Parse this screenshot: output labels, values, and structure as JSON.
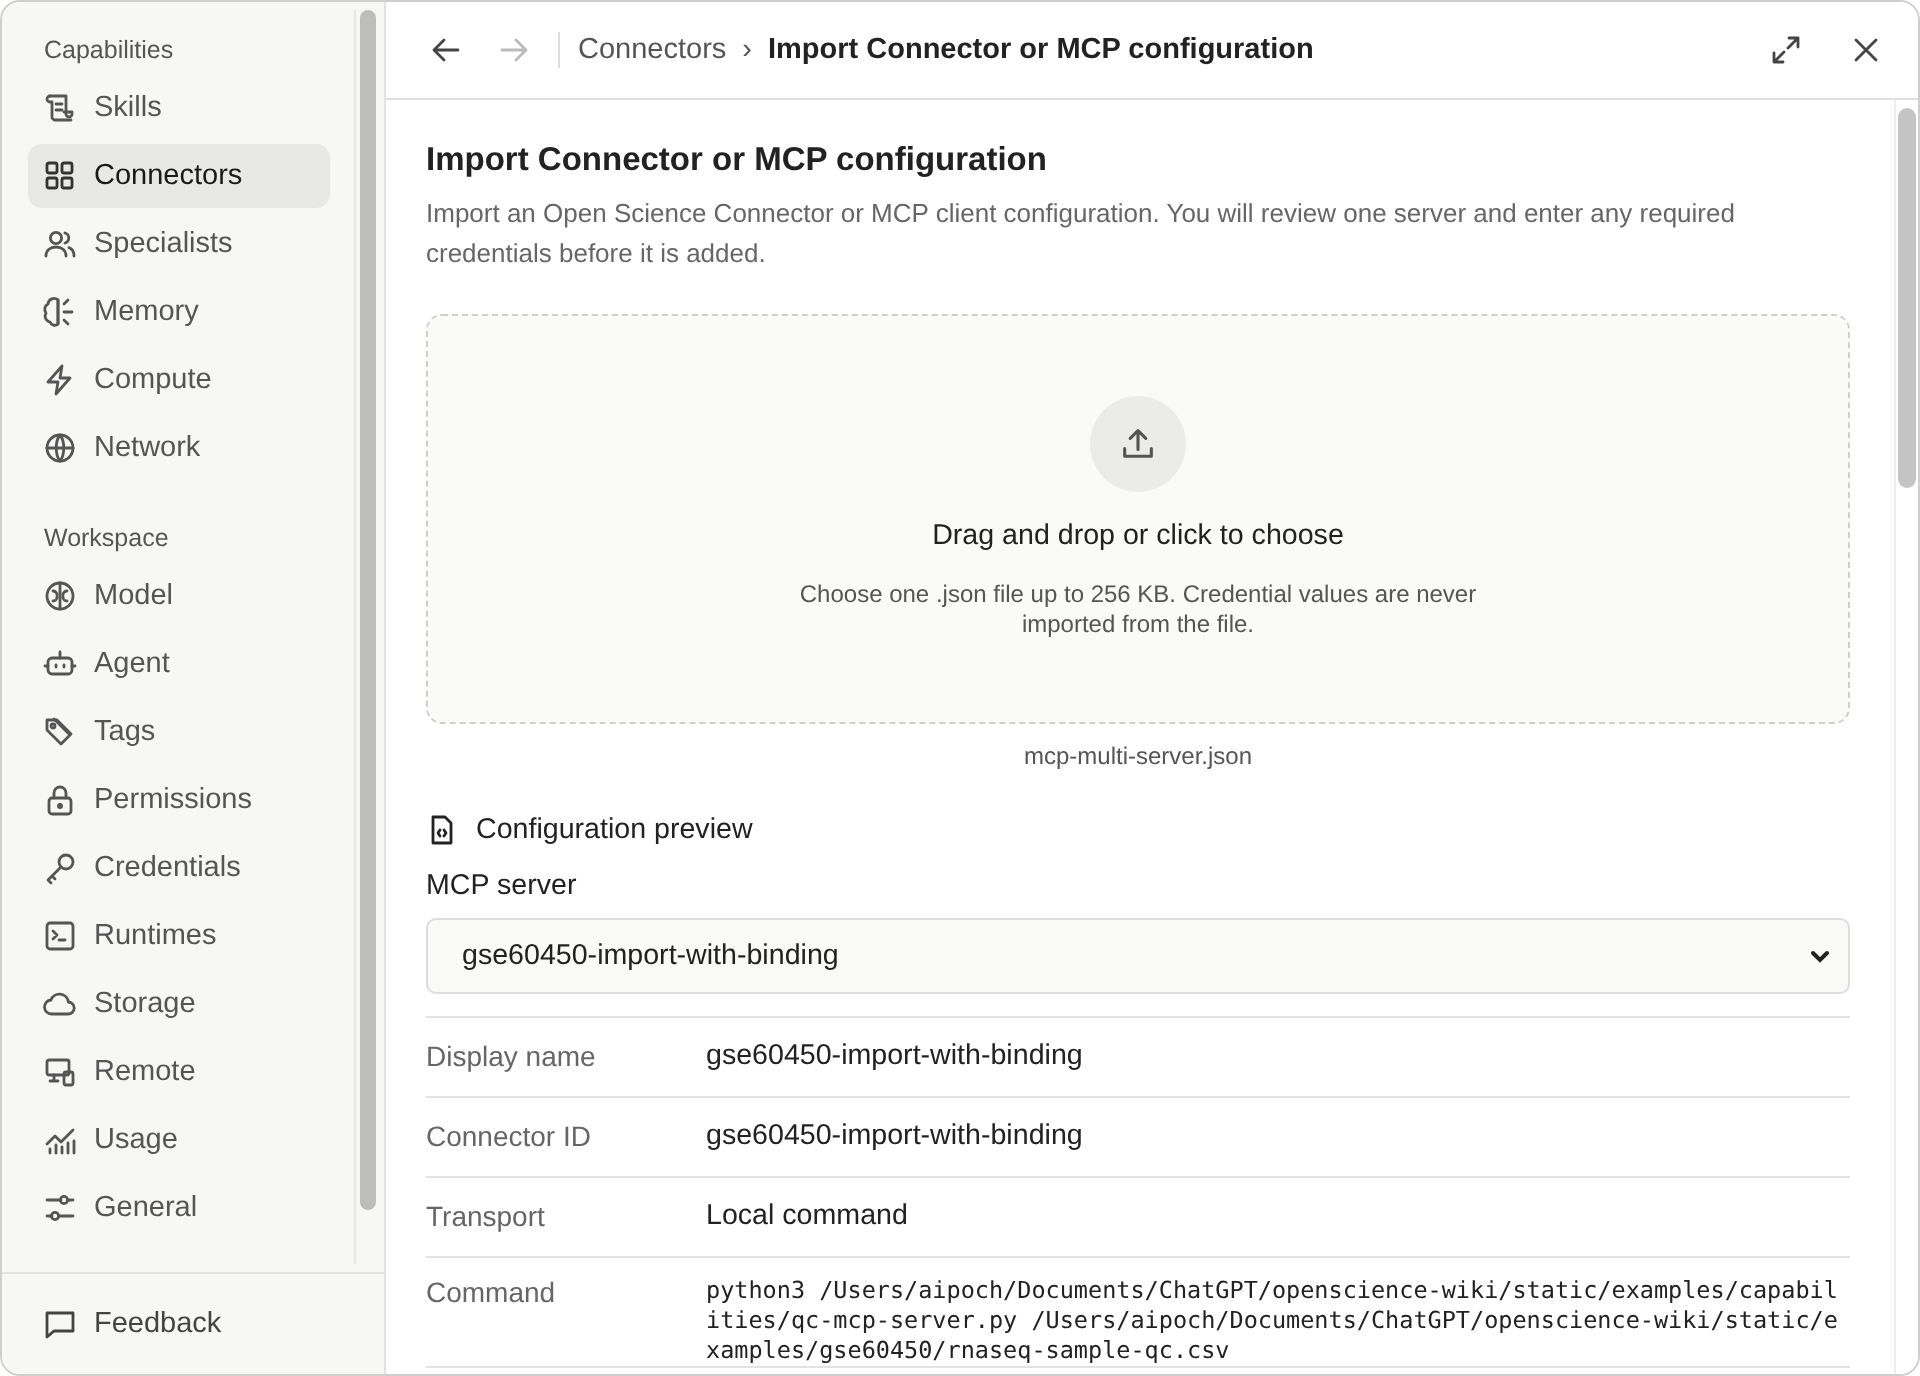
{
  "sidebar": {
    "sections": [
      {
        "title": "Capabilities",
        "items": [
          {
            "label": "Skills",
            "selected": false
          },
          {
            "label": "Connectors",
            "selected": true
          },
          {
            "label": "Specialists",
            "selected": false
          },
          {
            "label": "Memory",
            "selected": false
          },
          {
            "label": "Compute",
            "selected": false
          },
          {
            "label": "Network",
            "selected": false
          }
        ]
      },
      {
        "title": "Workspace",
        "items": [
          {
            "label": "Model",
            "selected": false
          },
          {
            "label": "Agent",
            "selected": false
          },
          {
            "label": "Tags",
            "selected": false
          },
          {
            "label": "Permissions",
            "selected": false
          },
          {
            "label": "Credentials",
            "selected": false
          },
          {
            "label": "Runtimes",
            "selected": false
          },
          {
            "label": "Storage",
            "selected": false
          },
          {
            "label": "Remote",
            "selected": false
          },
          {
            "label": "Usage",
            "selected": false
          },
          {
            "label": "General",
            "selected": false
          }
        ]
      }
    ],
    "footer": {
      "label": "Feedback"
    }
  },
  "header": {
    "breadcrumb": {
      "parent": "Connectors",
      "separator": "›",
      "current": "Import Connector or MCP configuration"
    },
    "forward_disabled": true
  },
  "content": {
    "title": "Import Connector or MCP configuration",
    "description": "Import an Open Science Connector or MCP client configuration. You will review one server and enter any required credentials before it is added.",
    "dropzone": {
      "title": "Drag and drop or click to choose",
      "hint": "Choose one .json file up to 256 KB. Credential values are never imported from the file.",
      "filename": "mcp-multi-server.json"
    },
    "preview": {
      "heading": "Configuration preview",
      "server_label": "MCP server",
      "server_value": "gse60450-import-with-binding",
      "fields": [
        {
          "label": "Display name",
          "value": "gse60450-import-with-binding",
          "kind": "text"
        },
        {
          "label": "Connector ID",
          "value": "gse60450-import-with-binding",
          "kind": "text"
        },
        {
          "label": "Transport",
          "value": "Local command",
          "kind": "text"
        },
        {
          "label": "Command",
          "value": "python3 /Users/aipoch/Documents/ChatGPT/openscience-wiki/static/examples/capabilities/qc-mcp-server.py /Users/aipoch/Documents/ChatGPT/openscience-wiki/static/examples/gse60450/rnaseq-sample-qc.csv",
          "kind": "code"
        }
      ]
    }
  }
}
